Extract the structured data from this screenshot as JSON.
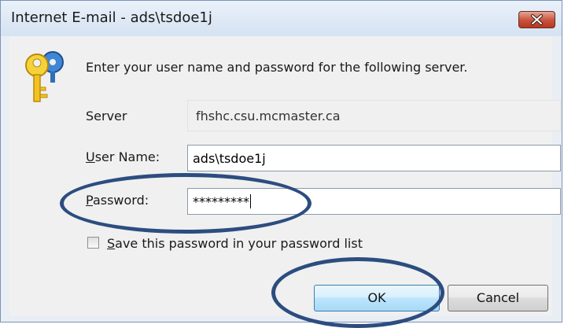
{
  "window": {
    "title": "Internet E-mail - ads\\tsdoe1j"
  },
  "dialog": {
    "prompt": "Enter your user name and password for the following server.",
    "server": {
      "label": "Server",
      "value": "fhshc.csu.mcmaster.ca"
    },
    "user_name": {
      "mnemonic": "U",
      "label_rest": "ser Name:",
      "value": "ads\\tsdoe1j"
    },
    "password": {
      "mnemonic": "P",
      "label_rest": "assword:",
      "value": "*********"
    },
    "save_password": {
      "mnemonic": "S",
      "label_rest": "ave this password in your password list",
      "checked": false
    },
    "ok_label": "OK",
    "cancel_label": "Cancel"
  },
  "icons": [
    "keys-icon",
    "close-icon",
    "checkbox-icon"
  ],
  "colors": {
    "annotation": "#2c4d80",
    "close_button": "#c8503b",
    "ok_button": "#bee6fd"
  }
}
